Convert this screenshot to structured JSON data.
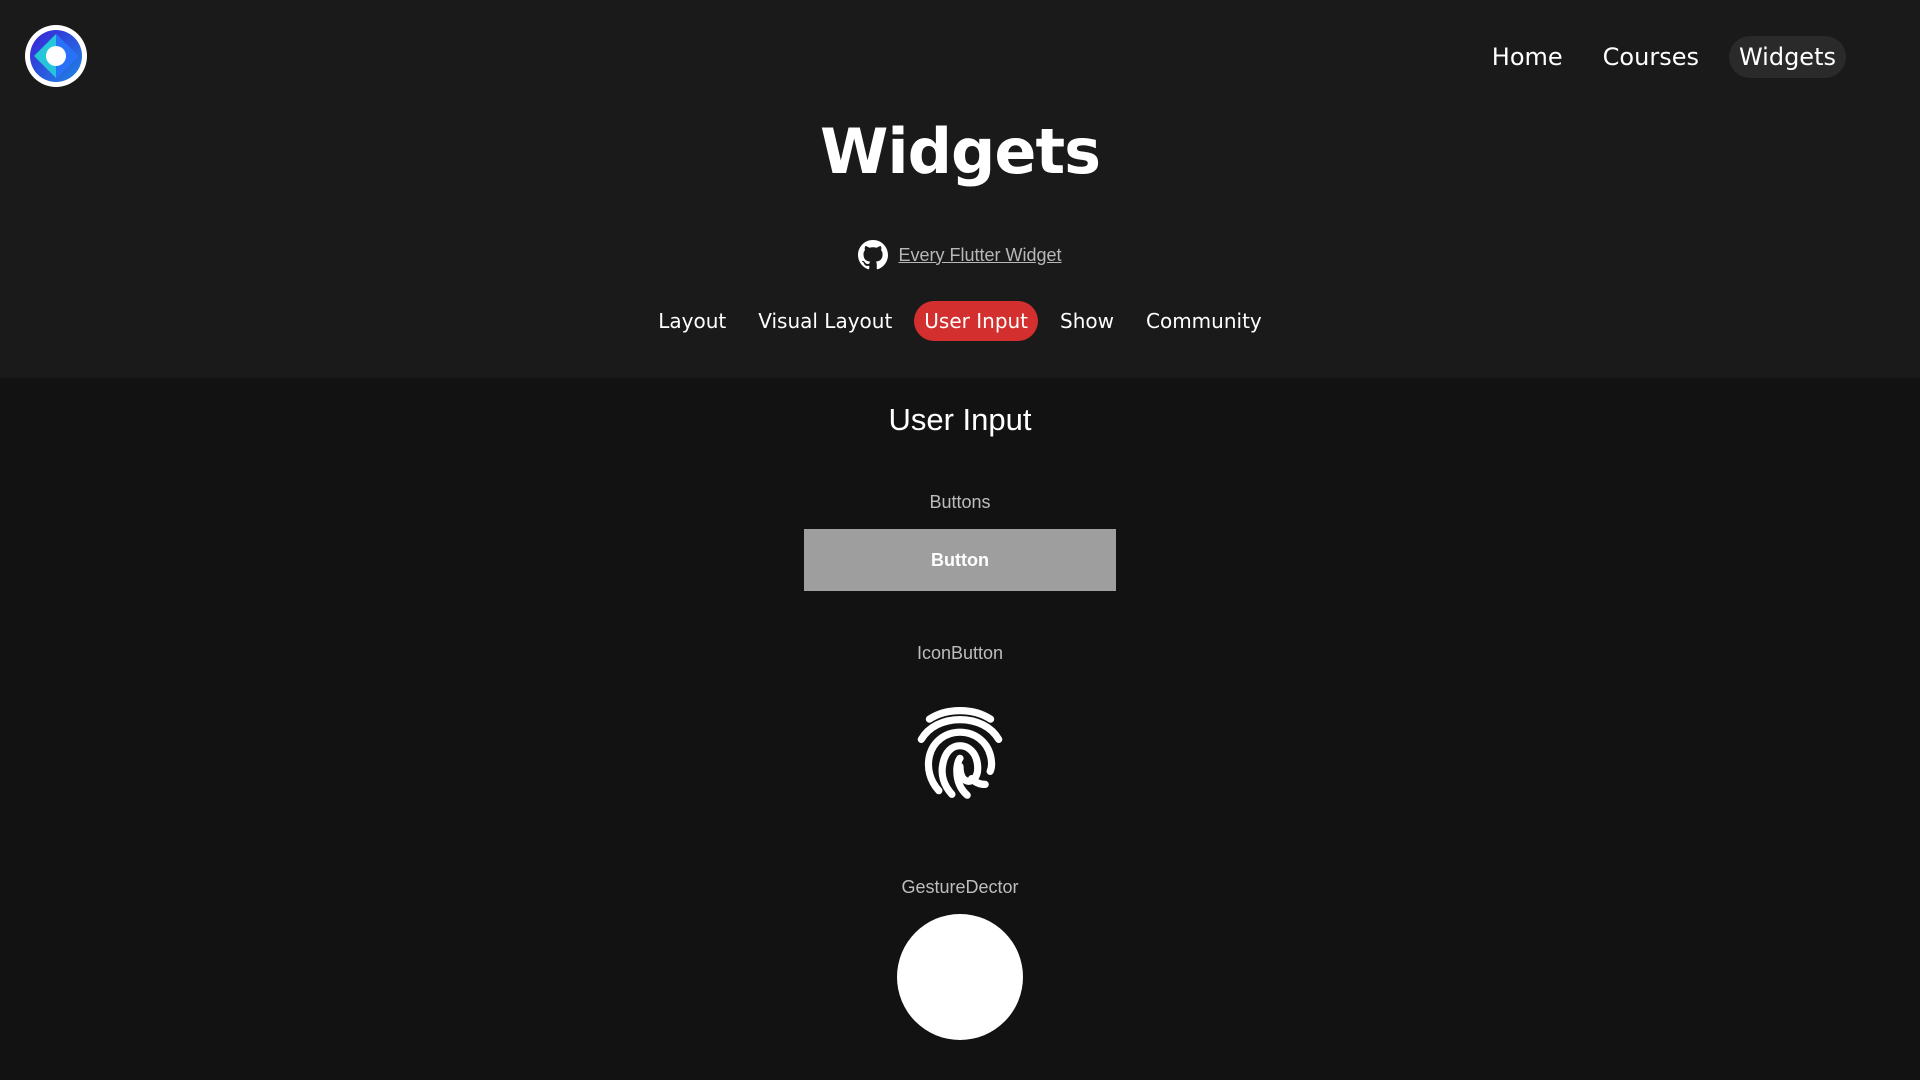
{
  "nav": {
    "items": [
      {
        "label": "Home",
        "active": false
      },
      {
        "label": "Courses",
        "active": false
      },
      {
        "label": "Widgets",
        "active": true
      }
    ]
  },
  "page": {
    "title": "Widgets",
    "repo_link": "Every Flutter Widget"
  },
  "categories": [
    {
      "label": "Layout",
      "active": false
    },
    {
      "label": "Visual Layout",
      "active": false
    },
    {
      "label": "User Input",
      "active": true
    },
    {
      "label": "Show",
      "active": false
    },
    {
      "label": "Community",
      "active": false
    }
  ],
  "section": {
    "title": "User Input",
    "widgets": {
      "buttons_label": "Buttons",
      "button_text": "Button",
      "iconbutton_label": "IconButton",
      "gesture_label": "GestureDector"
    }
  },
  "colors": {
    "background": "#121212",
    "header_background": "#1a1a1a",
    "active_category": "#d32f2f",
    "active_nav": "#2a2a2a",
    "button_fill": "#9e9e9e"
  },
  "icons": [
    "app-logo-icon",
    "github-icon",
    "fingerprint-icon"
  ]
}
